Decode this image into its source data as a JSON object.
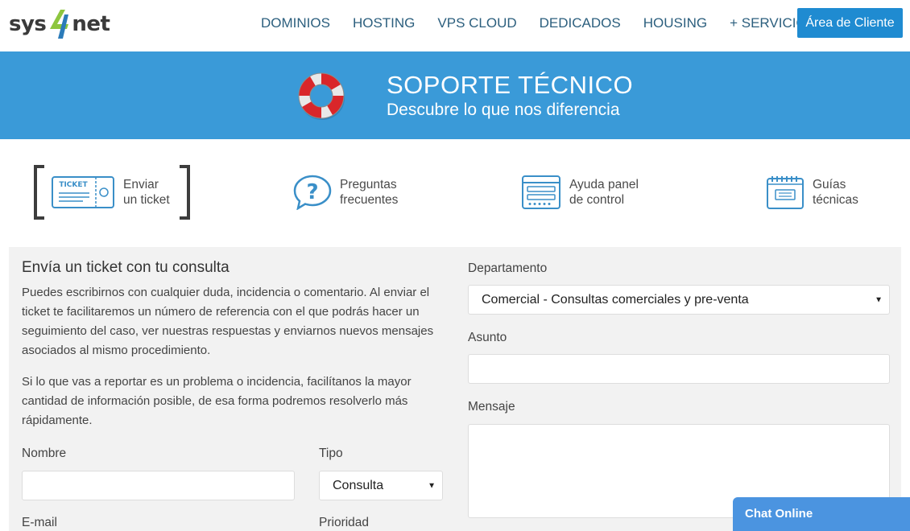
{
  "logo": {
    "left_text": "sys",
    "right_text": "net",
    "mark": "4-hand-mark"
  },
  "nav": {
    "items": [
      "DOMINIOS",
      "HOSTING",
      "VPS CLOUD",
      "DEDICADOS",
      "HOUSING",
      "+ SERVICIOS"
    ],
    "cta_label": "Área de Cliente"
  },
  "banner": {
    "title": "SOPORTE TÉCNICO",
    "subtitle": "Descubre lo que nos diferencia",
    "icon": "lifebuoy-icon"
  },
  "tabs": [
    {
      "line1": "Enviar",
      "line2": "un ticket",
      "icon": "ticket-icon",
      "active": true
    },
    {
      "line1": "Preguntas",
      "line2": "frecuentes",
      "icon": "faq-icon",
      "active": false
    },
    {
      "line1": "Ayuda panel",
      "line2": "de control",
      "icon": "control-panel-icon",
      "active": false
    },
    {
      "line1": "Guías",
      "line2": "técnicas",
      "icon": "guides-icon",
      "active": false
    }
  ],
  "ticket_icon_text": "TICKET",
  "form": {
    "title": "Envía un ticket con tu consulta",
    "para1": "Puedes escribirnos con cualquier duda, incidencia o comentario. Al enviar el ticket te facilitaremos un número de referencia con el que podrás hacer un seguimiento del caso, ver nuestras respuestas y enviarnos nuevos mensajes asociados al mismo procedimiento.",
    "para2": "Si lo que vas a reportar es un problema o incidencia, facilítanos la mayor cantidad de información posible, de esa forma podremos resolverlo más rápidamente.",
    "nombre_label": "Nombre",
    "nombre_value": "",
    "tipo_label": "Tipo",
    "tipo_value": "Consulta",
    "email_label": "E-mail",
    "prioridad_label": "Prioridad",
    "departamento_label": "Departamento",
    "departamento_value": "Comercial - Consultas comerciales y pre-venta",
    "asunto_label": "Asunto",
    "asunto_value": "",
    "mensaje_label": "Mensaje",
    "mensaje_value": ""
  },
  "chat": {
    "label": "Chat Online"
  },
  "colors": {
    "brand_blue": "#3a9ad8",
    "cta_blue": "#1f8bd1",
    "nav_text": "#2c5f7e",
    "icon_blue": "#3a8fc8",
    "chat_blue": "#4b94e0"
  }
}
